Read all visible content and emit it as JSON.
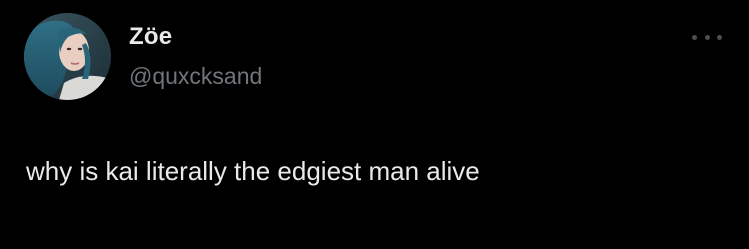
{
  "tweet": {
    "author": {
      "display_name": "Zöe",
      "handle": "@quxcksand",
      "avatar_icon": "profile-photo"
    },
    "more_icon": "more-dots-icon",
    "text": "why is kai literally the edgiest man alive"
  },
  "colors": {
    "background": "#000000",
    "primary_text": "#e7e9ea",
    "secondary_text": "#71767b",
    "more_dots": "#4b4f53"
  }
}
